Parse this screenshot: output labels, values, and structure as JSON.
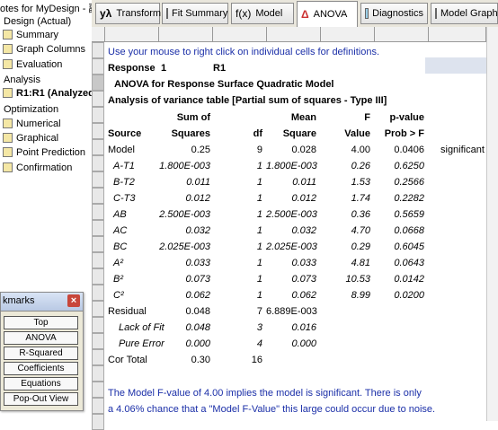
{
  "left_panel": {
    "title": "otes for MyDesign - 副本",
    "items": [
      {
        "label": "Design (Actual)",
        "indent": 0
      },
      {
        "label": "Summary",
        "icon": "summary-icon"
      },
      {
        "label": "Graph Columns",
        "icon": "graph-columns-icon"
      },
      {
        "label": "Evaluation",
        "icon": "evaluation-icon"
      },
      {
        "label": "Analysis",
        "indent": 0
      },
      {
        "label": "R1:R1 (Analyzed)",
        "icon": "analyzed-icon",
        "selected": true
      },
      {
        "label": "Optimization",
        "indent": 0
      },
      {
        "label": "Numerical",
        "icon": "numerical-icon"
      },
      {
        "label": "Graphical",
        "icon": "graphical-icon"
      },
      {
        "label": "Point Prediction",
        "icon": "point-prediction-icon"
      },
      {
        "label": "Confirmation",
        "icon": "confirmation-icon"
      }
    ]
  },
  "toolbar": {
    "tabs": [
      {
        "label": "Transform",
        "glyph": "yλ"
      },
      {
        "label": "Fit Summary",
        "glyph": ""
      },
      {
        "label": "Model",
        "glyph": "f(x)"
      },
      {
        "label": "ANOVA",
        "glyph": "Δ",
        "active": true
      },
      {
        "label": "Diagnostics",
        "glyph": ""
      },
      {
        "label": "Model Graphs",
        "glyph": ""
      }
    ]
  },
  "report": {
    "hint": "Use your mouse to right click on individual cells for definitions.",
    "response_label": "Response",
    "response_num": "1",
    "response_name": "R1",
    "heading1": "ANOVA for Response Surface Quadratic Model",
    "heading2": "Analysis of variance table [Partial sum of squares - Type III]",
    "col_top": {
      "sum": "Sum of",
      "mean": "Mean",
      "f": "F",
      "p": "p-value"
    },
    "col_bottom": {
      "source": "Source",
      "sum": "Squares",
      "df": "df",
      "mean": "Square",
      "f": "Value",
      "p": "Prob > F"
    },
    "rows": [
      {
        "source": "Model",
        "ss": "0.25",
        "df": "9",
        "ms": "0.028",
        "f": "4.00",
        "p": "0.0406",
        "note": "significant",
        "style": "normal"
      },
      {
        "source": "A-T1",
        "ss": "1.800E-003",
        "df": "1",
        "ms": "1.800E-003",
        "f": "0.26",
        "p": "0.6250",
        "note": "",
        "style": "italic"
      },
      {
        "source": "B-T2",
        "ss": "0.011",
        "df": "1",
        "ms": "0.011",
        "f": "1.53",
        "p": "0.2566",
        "note": "",
        "style": "italic"
      },
      {
        "source": "C-T3",
        "ss": "0.012",
        "df": "1",
        "ms": "0.012",
        "f": "1.74",
        "p": "0.2282",
        "note": "",
        "style": "italic"
      },
      {
        "source": "AB",
        "ss": "2.500E-003",
        "df": "1",
        "ms": "2.500E-003",
        "f": "0.36",
        "p": "0.5659",
        "note": "",
        "style": "italic"
      },
      {
        "source": "AC",
        "ss": "0.032",
        "df": "1",
        "ms": "0.032",
        "f": "4.70",
        "p": "0.0668",
        "note": "",
        "style": "italic"
      },
      {
        "source": "BC",
        "ss": "2.025E-003",
        "df": "1",
        "ms": "2.025E-003",
        "f": "0.29",
        "p": "0.6045",
        "note": "",
        "style": "italic"
      },
      {
        "source": "A²",
        "ss": "0.033",
        "df": "1",
        "ms": "0.033",
        "f": "4.81",
        "p": "0.0643",
        "note": "",
        "style": "italic"
      },
      {
        "source": "B²",
        "ss": "0.073",
        "df": "1",
        "ms": "0.073",
        "f": "10.53",
        "p": "0.0142",
        "note": "",
        "style": "italic"
      },
      {
        "source": "C²",
        "ss": "0.062",
        "df": "1",
        "ms": "0.062",
        "f": "8.99",
        "p": "0.0200",
        "note": "",
        "style": "italic"
      },
      {
        "source": "Residual",
        "ss": "0.048",
        "df": "7",
        "ms": "6.889E-003",
        "f": "",
        "p": "",
        "note": "",
        "style": "normal"
      },
      {
        "source": "Lack of Fit",
        "ss": "0.048",
        "df": "3",
        "ms": "0.016",
        "f": "",
        "p": "",
        "note": "",
        "style": "italic-indent"
      },
      {
        "source": "Pure Error",
        "ss": "0.000",
        "df": "4",
        "ms": "0.000",
        "f": "",
        "p": "",
        "note": "",
        "style": "italic-indent"
      },
      {
        "source": "Cor Total",
        "ss": "0.30",
        "df": "16",
        "ms": "",
        "f": "",
        "p": "",
        "note": "",
        "style": "normal"
      }
    ],
    "footer1": "The Model F-value of 4.00 implies the model is significant.  There is only",
    "footer2": "a 4.06% chance that a \"Model F-Value\" this large could occur due to noise."
  },
  "bookmarks": {
    "title": "kmarks",
    "buttons": [
      "Top",
      "ANOVA",
      "R-Squared",
      "Coefficients",
      "Equations",
      "Pop-Out View"
    ]
  },
  "colors": {
    "blue_text": "#1b2fa8",
    "panel_bg": "#ece9d8"
  }
}
